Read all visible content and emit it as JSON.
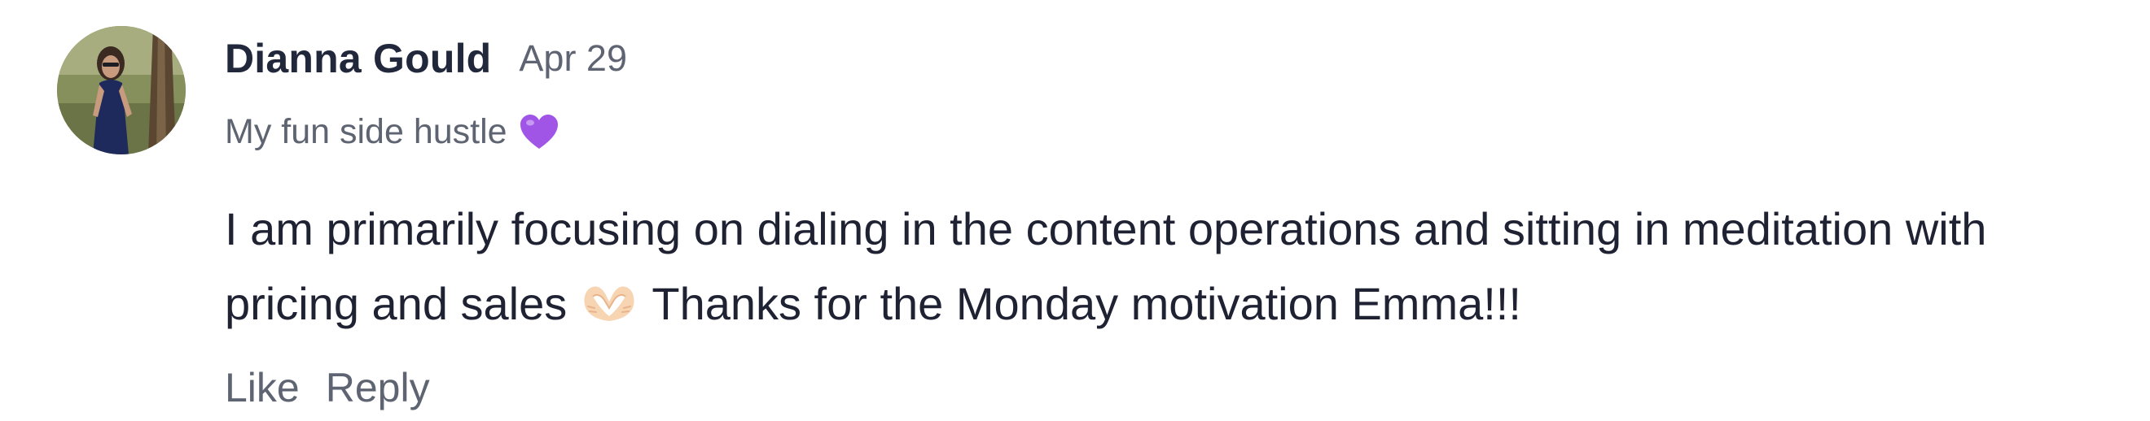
{
  "comment": {
    "author": "Dianna Gould",
    "date": "Apr 29",
    "tagline": "My fun side hustle",
    "tagline_emoji": "purple-heart-icon",
    "body_part1": "I am primarily focusing on dialing in the content operations and sitting in meditation with pricing and sales",
    "body_emoji": "heart-hands-icon",
    "body_part2": "Thanks for the Monday motivation Emma!!!"
  },
  "actions": {
    "like_label": "Like",
    "reply_label": "Reply"
  },
  "colors": {
    "text_primary": "#1f2233",
    "text_secondary": "#5e6471",
    "emoji_purple": "#a155e6"
  }
}
